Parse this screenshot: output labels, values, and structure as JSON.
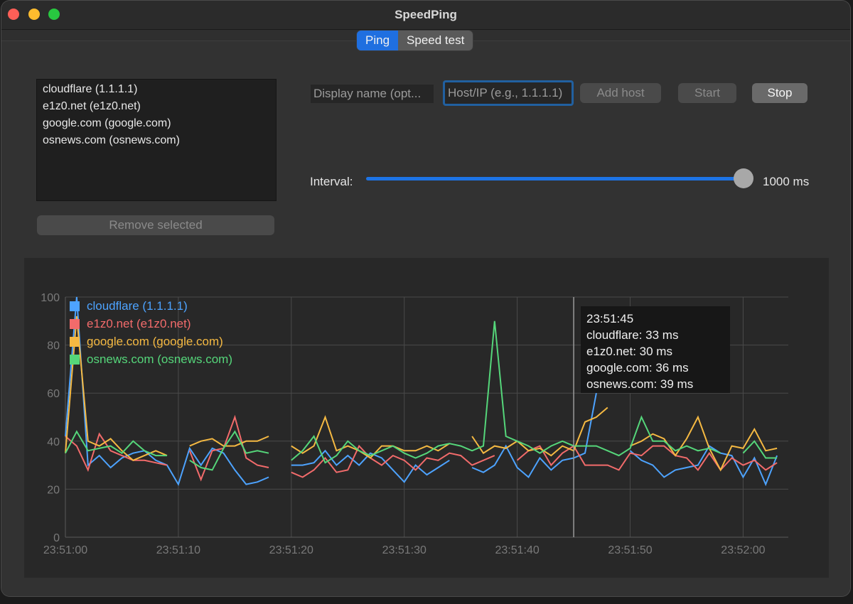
{
  "window": {
    "title": "SpeedPing"
  },
  "tabs": [
    {
      "label": "Ping",
      "active": true
    },
    {
      "label": "Speed test",
      "active": false
    }
  ],
  "hosts": [
    "cloudflare (1.1.1.1)",
    "e1z0.net (e1z0.net)",
    "google.com (google.com)",
    "osnews.com (osnews.com)"
  ],
  "controls": {
    "display_name_placeholder": "Display name (opt...",
    "host_placeholder": "Host/IP (e.g., 1.1.1.1)",
    "add_host": "Add host",
    "start": "Start",
    "stop": "Stop",
    "remove_selected": "Remove selected",
    "interval_label": "Interval:",
    "interval_value": "1000 ms",
    "interval_fraction": 1.0
  },
  "tooltip": {
    "time": "23:51:45",
    "lines": [
      "cloudflare: 33 ms",
      "e1z0.net: 30 ms",
      "google.com: 36 ms",
      "osnews.com: 39 ms"
    ]
  },
  "colors": {
    "accent": "#1f6fe0",
    "cloudflare": "#4da3ff",
    "e1z0": "#f26b6b",
    "google": "#f5b942",
    "osnews": "#55d67a"
  },
  "chart_data": {
    "type": "line",
    "ylim": [
      0,
      100
    ],
    "yticks": [
      0,
      20,
      40,
      60,
      80,
      100
    ],
    "xlim": [
      "23:51:00",
      "23:52:04"
    ],
    "xtick_labels": [
      "23:51:00",
      "23:51:10",
      "23:51:20",
      "23:51:30",
      "23:51:40",
      "23:51:50",
      "23:52:00"
    ],
    "x": [
      "23:51:00",
      "23:51:01",
      "23:51:02",
      "23:51:03",
      "23:51:04",
      "23:51:05",
      "23:51:06",
      "23:51:07",
      "23:51:08",
      "23:51:09",
      "23:51:10",
      "23:51:11",
      "23:51:12",
      "23:51:13",
      "23:51:14",
      "23:51:15",
      "23:51:16",
      "23:51:17",
      "23:51:18",
      "23:51:19",
      "23:51:20",
      "23:51:21",
      "23:51:22",
      "23:51:23",
      "23:51:24",
      "23:51:25",
      "23:51:26",
      "23:51:27",
      "23:51:28",
      "23:51:29",
      "23:51:30",
      "23:51:31",
      "23:51:32",
      "23:51:33",
      "23:51:34",
      "23:51:35",
      "23:51:36",
      "23:51:37",
      "23:51:38",
      "23:51:39",
      "23:51:40",
      "23:51:41",
      "23:51:42",
      "23:51:43",
      "23:51:44",
      "23:51:45",
      "23:51:46",
      "23:51:47",
      "23:51:48",
      "23:51:49",
      "23:51:50",
      "23:51:51",
      "23:51:52",
      "23:51:53",
      "23:51:54",
      "23:51:55",
      "23:51:56",
      "23:51:57",
      "23:51:58",
      "23:51:59",
      "23:52:00",
      "23:52:01",
      "23:52:02",
      "23:52:03"
    ],
    "series": [
      {
        "name": "cloudflare (1.1.1.1)",
        "color": "#4da3ff",
        "values": [
          42,
          100,
          30,
          34,
          29,
          33,
          35,
          36,
          32,
          30,
          22,
          37,
          30,
          37,
          35,
          28,
          22,
          23,
          25,
          null,
          30,
          30,
          31,
          36,
          30,
          34,
          30,
          35,
          33,
          28,
          23,
          30,
          26,
          29,
          32,
          null,
          29,
          27,
          30,
          38,
          29,
          25,
          33,
          28,
          32,
          33,
          35,
          60,
          null,
          null,
          36,
          32,
          30,
          25,
          28,
          29,
          30,
          38,
          35,
          34,
          25,
          33,
          22,
          34
        ]
      },
      {
        "name": "e1z0.net (e1z0.net)",
        "color": "#f26b6b",
        "values": [
          42,
          38,
          28,
          43,
          36,
          34,
          32,
          32,
          31,
          30,
          null,
          36,
          24,
          36,
          37,
          50,
          33,
          30,
          29,
          null,
          27,
          25,
          28,
          33,
          27,
          28,
          38,
          33,
          30,
          34,
          32,
          28,
          33,
          32,
          35,
          34,
          30,
          32,
          34,
          null,
          32,
          36,
          38,
          30,
          35,
          38,
          30,
          30,
          30,
          28,
          35,
          34,
          38,
          38,
          34,
          33,
          28,
          35,
          28,
          33,
          30,
          32,
          28,
          31
        ]
      },
      {
        "name": "google.com (google.com)",
        "color": "#f5b942",
        "values": [
          35,
          92,
          40,
          38,
          41,
          36,
          32,
          34,
          36,
          34,
          null,
          38,
          40,
          41,
          38,
          38,
          40,
          40,
          42,
          null,
          38,
          35,
          38,
          50,
          36,
          38,
          36,
          33,
          38,
          38,
          36,
          36,
          38,
          36,
          39,
          null,
          42,
          35,
          38,
          37,
          40,
          36,
          37,
          34,
          38,
          36,
          48,
          50,
          54,
          null,
          38,
          40,
          43,
          41,
          34,
          41,
          50,
          37,
          28,
          38,
          37,
          45,
          36,
          37
        ]
      },
      {
        "name": "osnews.com (osnews.com)",
        "color": "#55d67a",
        "values": [
          35,
          44,
          36,
          37,
          38,
          35,
          40,
          36,
          34,
          34,
          null,
          32,
          29,
          28,
          37,
          44,
          35,
          36,
          35,
          null,
          32,
          36,
          42,
          31,
          34,
          40,
          36,
          34,
          36,
          38,
          35,
          33,
          35,
          38,
          39,
          38,
          36,
          38,
          90,
          42,
          40,
          38,
          35,
          38,
          40,
          38,
          38,
          38,
          36,
          34,
          37,
          50,
          40,
          40,
          36,
          38,
          36,
          37,
          35,
          null,
          35,
          40,
          33,
          33
        ]
      }
    ]
  }
}
